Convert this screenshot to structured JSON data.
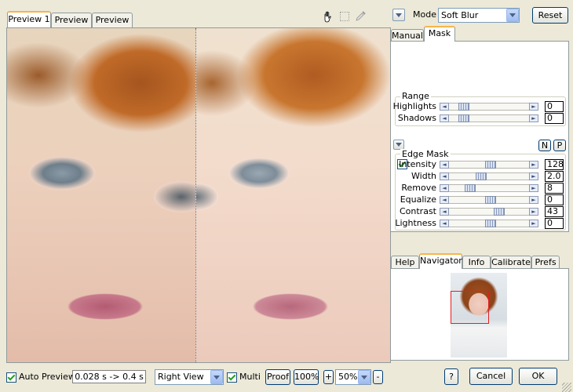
{
  "preview": {
    "tabs": [
      "Preview 1",
      "Preview 2",
      "Preview 3"
    ],
    "active_tab": 0
  },
  "tools": [
    "hand-icon",
    "marquee-icon",
    "eyedropper-icon"
  ],
  "mode": {
    "label": "Mode",
    "value": "Soft Blur"
  },
  "reset_label": "Reset",
  "settings_tabs": [
    "Manual",
    "Mask"
  ],
  "range": {
    "title": "Range",
    "sliders": [
      {
        "label": "Highlights",
        "value": "0",
        "pos": 0.13
      },
      {
        "label": "Shadows",
        "value": "0",
        "pos": 0.13
      }
    ]
  },
  "edge_mask": {
    "title": "Edge Mask",
    "buttons": [
      "N",
      "P"
    ],
    "sliders": [
      {
        "label": "Intensity",
        "value": "128",
        "pos": 0.51,
        "checkbox": true
      },
      {
        "label": "Width",
        "value": "2.0",
        "pos": 0.37
      },
      {
        "label": "Remove",
        "value": "8",
        "pos": 0.22
      },
      {
        "label": "Equalize",
        "value": "0",
        "pos": 0.51
      },
      {
        "label": "Contrast",
        "value": "43",
        "pos": 0.64
      },
      {
        "label": "Lightness",
        "value": "0",
        "pos": 0.51
      }
    ]
  },
  "nav_tabs": [
    "Help",
    "Navigator",
    "Info",
    "Calibrate",
    "Prefs"
  ],
  "nav_active": 1,
  "bottom": {
    "auto_preview": "Auto Preview",
    "timing": "0.028 s -> 0.4 s",
    "view": "Right View",
    "multi": "Multi",
    "proof": "Proof",
    "zoom_100": "100%",
    "plus": "+",
    "zoom": "50%",
    "minus": "-"
  },
  "help_label": "?",
  "cancel_label": "Cancel",
  "ok_label": "OK",
  "colors": {
    "tab_accent": "#f7b44a",
    "navigator_box": "#e0201e",
    "panel_bg": "#ece9d8"
  }
}
